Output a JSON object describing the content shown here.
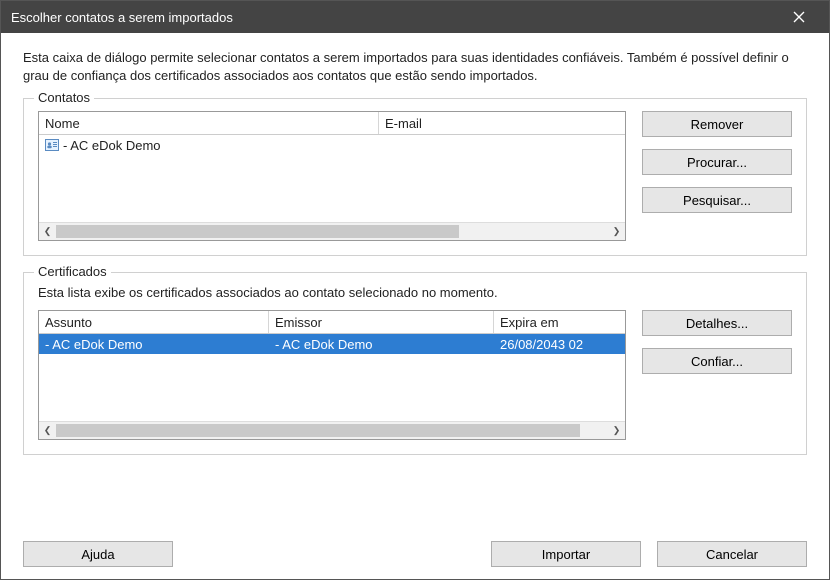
{
  "titlebar": {
    "title": "Escolher contatos a serem importados"
  },
  "description": "Esta caixa de diálogo permite selecionar contatos a serem importados para suas identidades confiáveis. Também é possível definir o grau de confiança dos certificados associados aos contatos que estão sendo importados.",
  "contacts": {
    "legend": "Contatos",
    "columns": {
      "name": "Nome",
      "email": "E-mail"
    },
    "rows": [
      {
        "name": "- AC eDok Demo",
        "email": ""
      }
    ],
    "buttons": {
      "remove": "Remover",
      "browse": "Procurar...",
      "search": "Pesquisar..."
    }
  },
  "certificates": {
    "legend": "Certificados",
    "intro": "Esta lista exibe os certificados associados ao contato selecionado no momento.",
    "columns": {
      "subject": "Assunto",
      "issuer": "Emissor",
      "expires": "Expira em"
    },
    "rows": [
      {
        "subject": "- AC eDok Demo",
        "issuer": "- AC eDok Demo",
        "expires": "26/08/2043 02"
      }
    ],
    "buttons": {
      "details": "Detalhes...",
      "trust": "Confiar..."
    }
  },
  "bottom": {
    "help": "Ajuda",
    "import": "Importar",
    "cancel": "Cancelar"
  }
}
